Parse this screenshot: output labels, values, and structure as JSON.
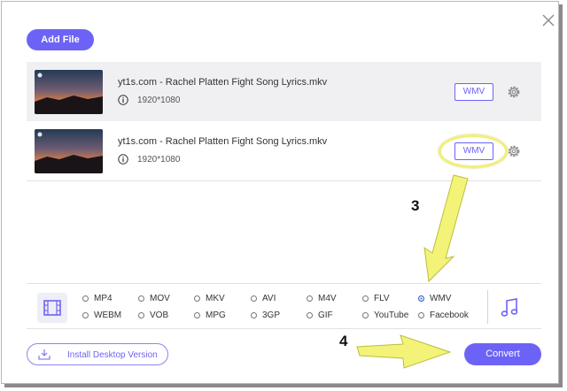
{
  "toolbar": {
    "add_file_label": "Add File"
  },
  "files": [
    {
      "name": "yt1s.com - Rachel Platten Fight Song Lyrics.mkv",
      "resolution": "1920*1080",
      "format": "WMV"
    },
    {
      "name": "yt1s.com - Rachel Platten Fight Song Lyrics.mkv",
      "resolution": "1920*1080",
      "format": "WMV"
    }
  ],
  "annotations": {
    "step3": "3",
    "step4": "4",
    "highlight_color": "#f0f07a"
  },
  "formats": {
    "row1": [
      "MP4",
      "MOV",
      "MKV",
      "AVI",
      "M4V",
      "FLV",
      "WMV"
    ],
    "row2": [
      "WEBM",
      "VOB",
      "MPG",
      "3GP",
      "GIF",
      "YouTube",
      "Facebook"
    ],
    "selected": "WMV"
  },
  "footer": {
    "install_label": "Install Desktop Version",
    "convert_label": "Convert"
  },
  "colors": {
    "accent": "#6c63f6",
    "arrow": "#f3f378"
  },
  "icons": [
    "close-icon",
    "info-icon",
    "gear-icon",
    "video-format-icon",
    "music-icon",
    "download-icon"
  ]
}
